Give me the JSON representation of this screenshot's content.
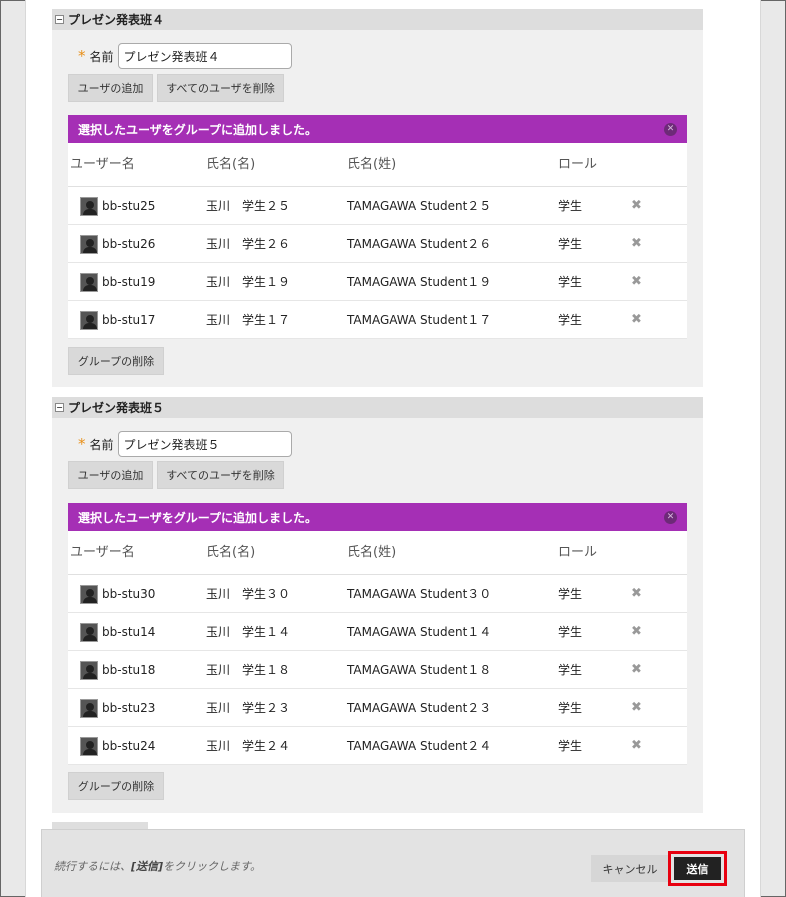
{
  "groups": [
    {
      "title": "プレゼン発表班４",
      "name_label": "名前",
      "name_value": "プレゼン発表班４",
      "add_users_label": "ユーザの追加",
      "remove_all_label": "すべてのユーザを削除",
      "banner": "選択したユーザをグループに追加しました。",
      "columns": [
        "ユーザー名",
        "氏名(名)",
        "氏名(姓)",
        "ロール"
      ],
      "rows": [
        {
          "user": "bb-stu25",
          "first": "玉川　学生２５",
          "last": "TAMAGAWA Student２５",
          "role": "学生"
        },
        {
          "user": "bb-stu26",
          "first": "玉川　学生２６",
          "last": "TAMAGAWA Student２６",
          "role": "学生"
        },
        {
          "user": "bb-stu19",
          "first": "玉川　学生１９",
          "last": "TAMAGAWA Student１９",
          "role": "学生"
        },
        {
          "user": "bb-stu17",
          "first": "玉川　学生１７",
          "last": "TAMAGAWA Student１７",
          "role": "学生"
        }
      ],
      "delete_group_label": "グループの削除"
    },
    {
      "title": "プレゼン発表班５",
      "name_label": "名前",
      "name_value": "プレゼン発表班５",
      "add_users_label": "ユーザの追加",
      "remove_all_label": "すべてのユーザを削除",
      "banner": "選択したユーザをグループに追加しました。",
      "columns": [
        "ユーザー名",
        "氏名(名)",
        "氏名(姓)",
        "ロール"
      ],
      "rows": [
        {
          "user": "bb-stu30",
          "first": "玉川　学生３０",
          "last": "TAMAGAWA Student３０",
          "role": "学生"
        },
        {
          "user": "bb-stu14",
          "first": "玉川　学生１４",
          "last": "TAMAGAWA Student１４",
          "role": "学生"
        },
        {
          "user": "bb-stu18",
          "first": "玉川　学生１８",
          "last": "TAMAGAWA Student１８",
          "role": "学生"
        },
        {
          "user": "bb-stu23",
          "first": "玉川　学生２３",
          "last": "TAMAGAWA Student２３",
          "role": "学生"
        },
        {
          "user": "bb-stu24",
          "first": "玉川　学生２４",
          "last": "TAMAGAWA Student２４",
          "role": "学生"
        }
      ],
      "delete_group_label": "グループの削除"
    }
  ],
  "footer": {
    "instruction_prefix": "続行するには、",
    "instruction_key": "[送信]",
    "instruction_suffix": "をクリックします。",
    "cancel_label": "キャンセル",
    "submit_label": "送信"
  },
  "colors": {
    "banner": "#a52fb5",
    "submit_highlight": "#e8000f",
    "required_star": "#e8901a"
  },
  "icons": {
    "collapse": "collapse-toggle-icon",
    "avatar": "user-avatar-icon",
    "remove": "remove-x-icon",
    "close": "close-banner-icon",
    "required": "required-star-icon"
  }
}
